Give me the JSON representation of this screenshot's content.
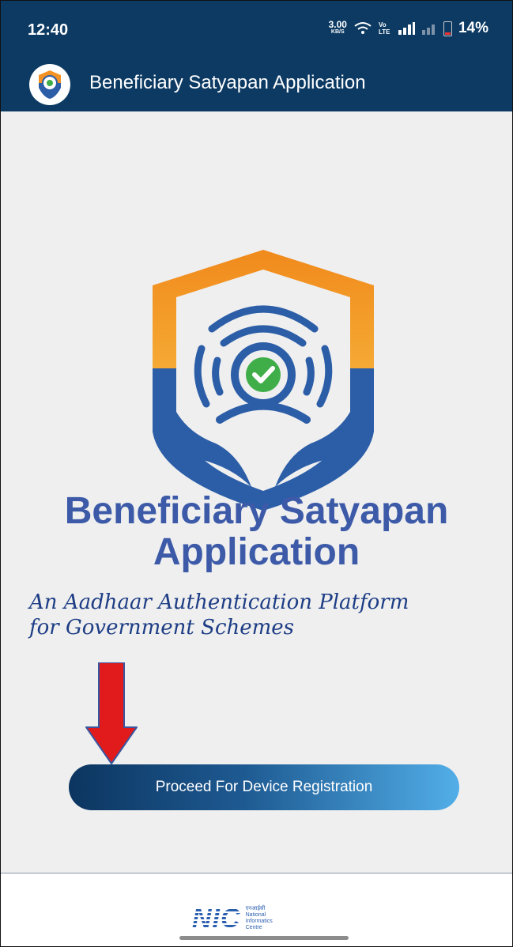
{
  "status_bar": {
    "time": "12:40",
    "net_speed_value": "3.00",
    "net_speed_unit": "KB/S",
    "volte_label": "Vo LTE",
    "battery": "14%"
  },
  "app_bar": {
    "title": "Beneficiary Satyapan Application"
  },
  "main": {
    "heading_line1": "Beneficiary Satyapan",
    "heading_line2": "Application",
    "tagline_line1": "An Aadhaar Authentication Platform",
    "tagline_line2": "for Government Schemes",
    "proceed_button": "Proceed For Device Registration"
  },
  "footer": {
    "logo_letters": "NIC",
    "logo_hindi": "एनआईसी",
    "logo_line1": "National",
    "logo_line2": "Informatics",
    "logo_line3": "Centre"
  },
  "colors": {
    "app_bar": "#0c3a63",
    "heading": "#3c5aa8",
    "tagline": "#1d3d85",
    "arrow": "#e11b1b",
    "shield_orange": "#f39224",
    "shield_blue": "#2c5ea8",
    "check_green": "#3fae49"
  }
}
